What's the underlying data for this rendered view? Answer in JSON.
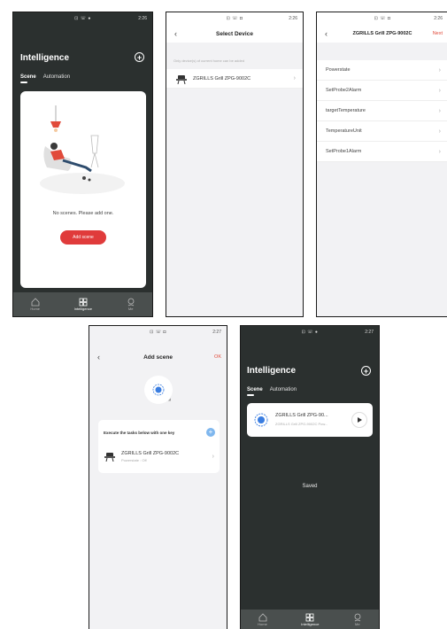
{
  "status": {
    "time_1": "2:26",
    "time_2": "2:26",
    "time_3": "2:26",
    "time_4": "2:27",
    "time_5": "2:27"
  },
  "screen1": {
    "title": "Intelligence",
    "tabs": [
      "Scene",
      "Automation"
    ],
    "empty_text": "No scenes. Please add one.",
    "add_button": "Add scene",
    "nav": [
      "Home",
      "Intelligence",
      "Me"
    ]
  },
  "screen2": {
    "title": "Select Device",
    "hint": "Only device(s) of current home can be added",
    "device": "ZGRILLS Grill ZPG-9002C"
  },
  "screen3": {
    "title": "ZGRILLS Grill ZPG-9002C",
    "next": "Next",
    "items": [
      "Powerstate",
      "SetProbe2Alarm",
      "targetTemperature",
      "TemperatureUnit",
      "SetProbe1Alarm"
    ]
  },
  "screen4": {
    "title": "Add scene",
    "ok": "OK",
    "section": "Execute the tasks below with one key",
    "device": "ZGRILLS Grill ZPG-9002C",
    "device_sub": "Powerstate : Off"
  },
  "screen5": {
    "title": "Intelligence",
    "tabs": [
      "Scene",
      "Automation"
    ],
    "scene_name": "ZGRILLS Grill ZPG-90...",
    "scene_sub": "ZGRILLS Grill ZPG-9002C Pow...",
    "saved": "Saved",
    "nav": [
      "Home",
      "Intelligence",
      "Me"
    ]
  }
}
